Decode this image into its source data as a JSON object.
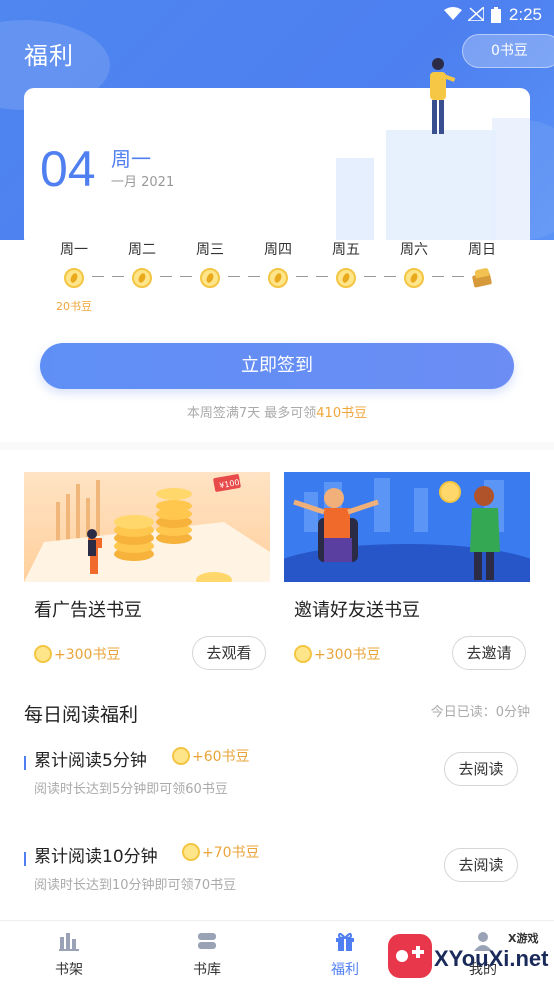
{
  "status_bar": {
    "time": "2:25"
  },
  "header": {
    "title": "福利",
    "bean_balance": "0书豆"
  },
  "sign_in": {
    "day": "04",
    "weekday": "周一",
    "month_year": "一月 2021",
    "days": [
      {
        "label": "周一",
        "reward": "20书豆"
      },
      {
        "label": "周二",
        "reward": ""
      },
      {
        "label": "周三",
        "reward": ""
      },
      {
        "label": "周四",
        "reward": ""
      },
      {
        "label": "周五",
        "reward": ""
      },
      {
        "label": "周六",
        "reward": ""
      },
      {
        "label": "周日",
        "reward": ""
      }
    ],
    "button_label": "立即签到",
    "note_prefix": "本周签满7天 最多可领",
    "note_highlight": "410书豆"
  },
  "tasks": [
    {
      "title": "看广告送书豆",
      "reward": "+300书豆",
      "button": "去观看",
      "tag": "¥100"
    },
    {
      "title": "邀请好友送书豆",
      "reward": "+300书豆",
      "button": "去邀请"
    }
  ],
  "daily_reading": {
    "title": "每日阅读福利",
    "today_read": "今日已读：0分钟",
    "items": [
      {
        "name": "累计阅读5分钟",
        "bonus": "+60书豆",
        "desc": "阅读时长达到5分钟即可领60书豆",
        "button": "去阅读"
      },
      {
        "name": "累计阅读10分钟",
        "bonus": "+70书豆",
        "desc": "阅读时长达到10分钟即可领70书豆",
        "button": "去阅读"
      }
    ]
  },
  "bottom_nav": [
    {
      "label": "书架",
      "icon": "bookshelf-icon"
    },
    {
      "label": "书库",
      "icon": "library-icon"
    },
    {
      "label": "福利",
      "icon": "gift-icon",
      "active": true
    },
    {
      "label": "我的",
      "icon": "profile-icon"
    }
  ],
  "watermark": {
    "small": "X游戏",
    "brand": "XYouXi.net"
  },
  "colors": {
    "primary": "#4f7ff0",
    "accent": "#e9a43a"
  }
}
